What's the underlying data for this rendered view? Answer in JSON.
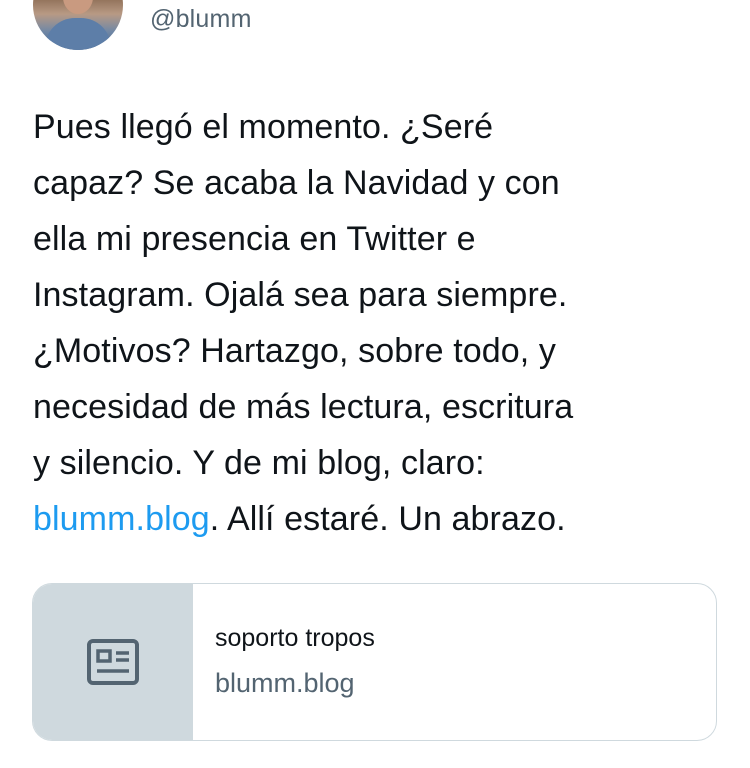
{
  "author": {
    "handle": "@blumm"
  },
  "tweet": {
    "lines": [
      "Pues llegó el momento. ¿Seré",
      "capaz? Se acaba la Navidad y con",
      "ella mi presencia en Twitter e",
      "Instagram. Ojalá sea para siempre.",
      "¿Motivos? Hartazgo, sobre todo, y",
      "necesidad de más lectura, escritura",
      "y silencio. Y de mi blog, claro:"
    ],
    "link_text": "blumm.blog",
    "last_line_rest": ". Allí estaré. Un abrazo."
  },
  "card": {
    "title": "soporto tropos",
    "domain": "blumm.blog",
    "icon": "article-icon"
  }
}
